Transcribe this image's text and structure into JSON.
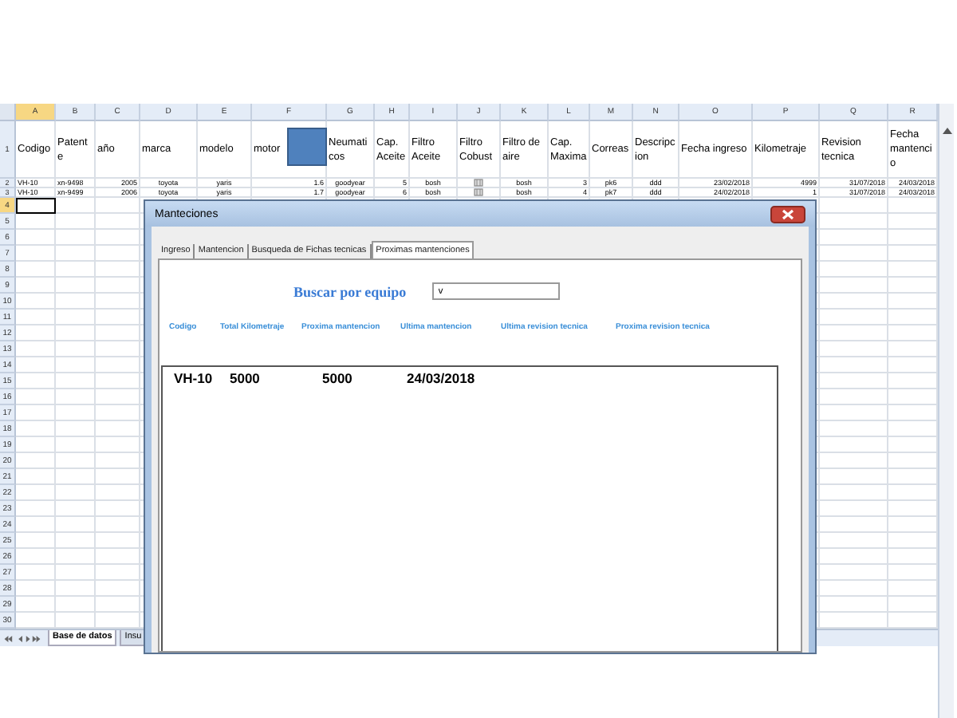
{
  "sheet": {
    "columns": [
      {
        "letter": "A",
        "selected": true
      },
      {
        "letter": "B",
        "selected": false
      },
      {
        "letter": "C",
        "selected": false
      },
      {
        "letter": "D",
        "selected": false
      },
      {
        "letter": "E",
        "selected": false
      },
      {
        "letter": "F",
        "selected": false
      },
      {
        "letter": "G",
        "selected": false
      },
      {
        "letter": "H",
        "selected": false
      },
      {
        "letter": "I",
        "selected": false
      },
      {
        "letter": "J",
        "selected": false
      },
      {
        "letter": "K",
        "selected": false
      },
      {
        "letter": "L",
        "selected": false
      },
      {
        "letter": "M",
        "selected": false
      },
      {
        "letter": "N",
        "selected": false
      },
      {
        "letter": "O",
        "selected": false
      },
      {
        "letter": "P",
        "selected": false
      },
      {
        "letter": "Q",
        "selected": false
      },
      {
        "letter": "R",
        "selected": false
      }
    ],
    "header_row": {
      "number": "1",
      "cells": [
        "Codigo",
        "Patente",
        "año",
        "marca",
        "modelo",
        "motor",
        "Neumaticos",
        "Cap. Aceite",
        "Filtro Aceite",
        "Filtro Cobust",
        "Filtro de aire",
        "Cap. Maxima",
        "Correas",
        "Descripcion",
        "Fecha ingreso",
        "Kilometraje",
        "Revision tecnica",
        "Fecha mantencio"
      ]
    },
    "data_rows": [
      {
        "number": "2",
        "cells": [
          "VH-10",
          "xn-9498",
          "2005",
          "toyota",
          "yaris",
          "1.6",
          "goodyear",
          "5",
          "bosh",
          {
            "kind": "icon"
          },
          "bosh",
          "3",
          "pk6",
          "ddd",
          "23/02/2018",
          "4999",
          "31/07/2018",
          "24/03/2018"
        ]
      },
      {
        "number": "3",
        "cells": [
          "VH-10",
          "xn-9499",
          "2006",
          "toyota",
          "yaris",
          "1.7",
          "goodyear",
          "6",
          "bosh",
          {
            "kind": "icon"
          },
          "bosh",
          "4",
          "pk7",
          "ddd",
          "24/02/2018",
          "1",
          "31/07/2018",
          "24/03/2018"
        ]
      }
    ],
    "empty_rows": [
      {
        "number": "4",
        "selected": true
      },
      {
        "number": "5",
        "selected": false
      },
      {
        "number": "6",
        "selected": false
      },
      {
        "number": "7",
        "selected": false
      },
      {
        "number": "8",
        "selected": false
      },
      {
        "number": "9",
        "selected": false
      },
      {
        "number": "10",
        "selected": false
      },
      {
        "number": "11",
        "selected": false
      },
      {
        "number": "12",
        "selected": false
      },
      {
        "number": "13",
        "selected": false
      },
      {
        "number": "14",
        "selected": false
      },
      {
        "number": "15",
        "selected": false
      },
      {
        "number": "16",
        "selected": false
      },
      {
        "number": "17",
        "selected": false
      },
      {
        "number": "18",
        "selected": false
      },
      {
        "number": "19",
        "selected": false
      },
      {
        "number": "20",
        "selected": false
      },
      {
        "number": "21",
        "selected": false
      },
      {
        "number": "22",
        "selected": false
      },
      {
        "number": "23",
        "selected": false
      },
      {
        "number": "24",
        "selected": false
      },
      {
        "number": "25",
        "selected": false
      },
      {
        "number": "26",
        "selected": false
      },
      {
        "number": "27",
        "selected": false
      },
      {
        "number": "28",
        "selected": false
      },
      {
        "number": "29",
        "selected": false
      },
      {
        "number": "30",
        "selected": false
      }
    ],
    "sheet_tabs": [
      {
        "label": "Base de datos",
        "selected": true
      },
      {
        "label": "Insu",
        "selected": false
      }
    ]
  },
  "dialog": {
    "title": "Manteciones",
    "tabs": [
      {
        "label": "Ingreso",
        "selected": false
      },
      {
        "label": "Mantencion",
        "selected": false
      },
      {
        "label": "Busqueda de Fichas tecnicas",
        "selected": false
      },
      {
        "label": "Proximas mantenciones",
        "selected": true
      }
    ],
    "search": {
      "label": "Buscar por equipo",
      "value": "v"
    },
    "list": {
      "columns": [
        "Codigo",
        "Total Kilometraje",
        "Proxima mantencion",
        "Ultima mantencion",
        "Ultima revision tecnica",
        "Proxima revision tecnica"
      ],
      "rows": [
        [
          "VH-10",
          "5000",
          "5000",
          "24/03/2018"
        ]
      ]
    }
  }
}
